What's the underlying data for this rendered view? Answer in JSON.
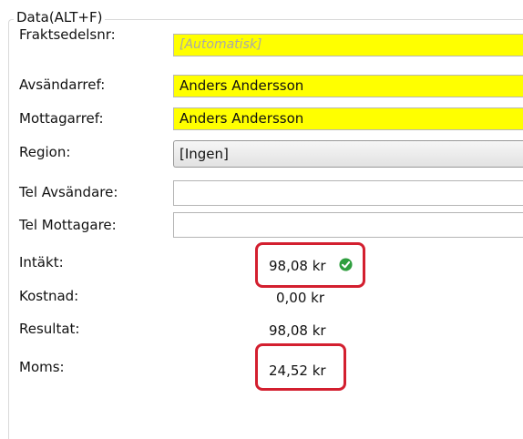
{
  "group": {
    "title": "Data(ALT+F)"
  },
  "fields": [
    {
      "label": "Fraktsedelsnr:",
      "value": "[Automatisk]"
    },
    {
      "label": "Avsändarref:",
      "value": "Anders Andersson"
    },
    {
      "label": "Mottagarref:",
      "value": "Anders Andersson"
    },
    {
      "label": "Region:",
      "value": "[Ingen]"
    },
    {
      "label": "Tel Avsändare:",
      "value": ""
    },
    {
      "label": "Tel Mottagare:",
      "value": ""
    }
  ],
  "totals": [
    {
      "label": "Intäkt:",
      "value": "98,08 kr"
    },
    {
      "label": "Kostnad:",
      "value": "0,00 kr"
    },
    {
      "label": "Resultat:",
      "value": "98,08 kr"
    },
    {
      "label": "Moms:",
      "value": "24,52 kr"
    }
  ],
  "colors": {
    "required_field": "#ffff00",
    "highlight_outline": "#d31f2f",
    "check_green": "#2e9e3e"
  },
  "icons": {
    "intakt_status": "check-circle-icon"
  }
}
